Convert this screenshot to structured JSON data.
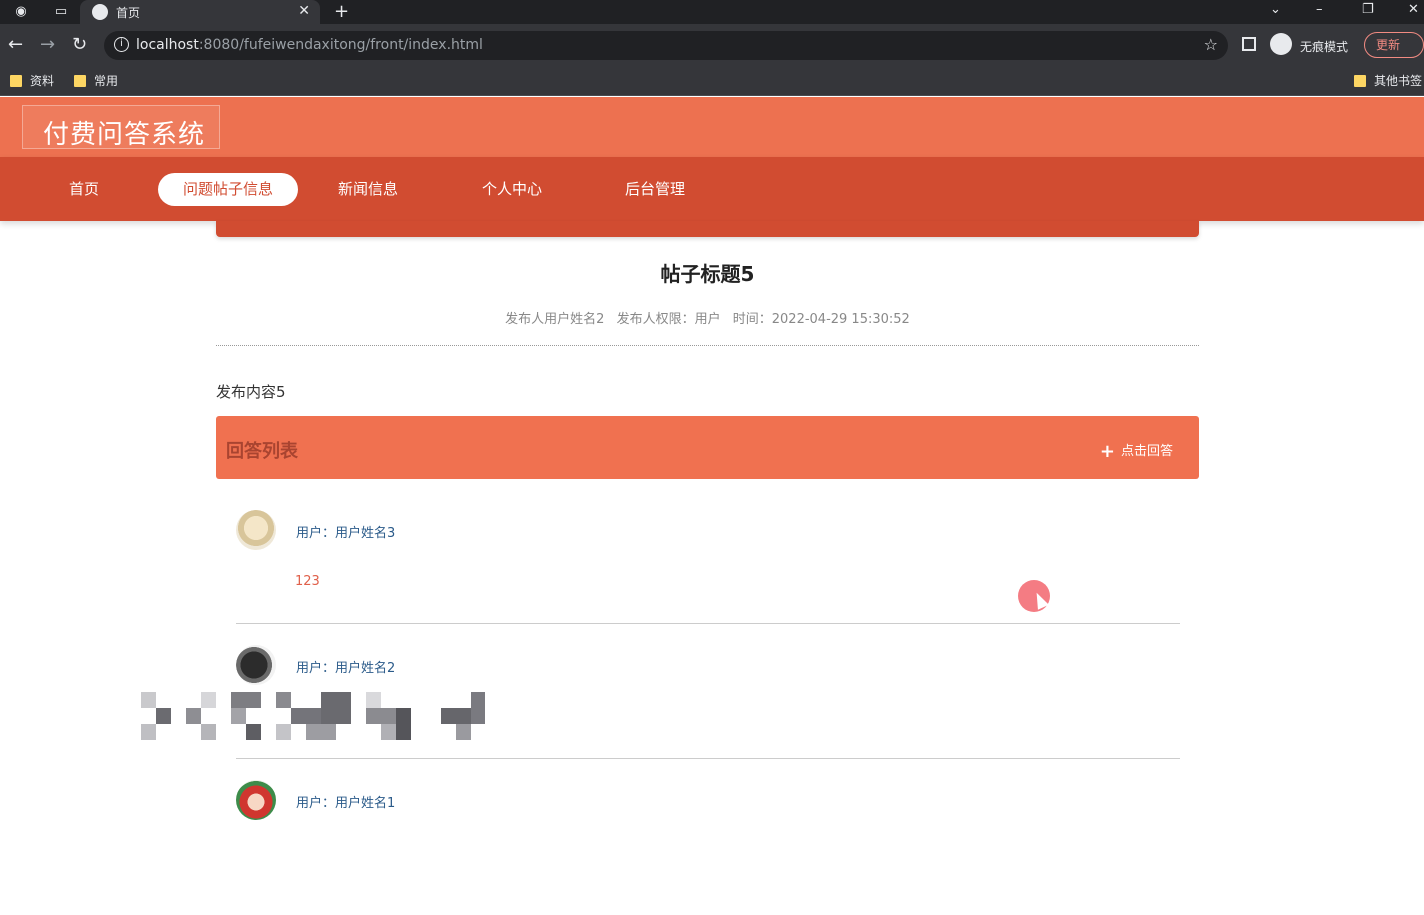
{
  "browser": {
    "tab_title": "首页",
    "new_tab": "+",
    "url_host": "localhost",
    "url_rest": ":8080/fufeiwendaxitong/front/index.html",
    "incognito_label": "无痕模式",
    "update_label": "更新",
    "bookmarks": [
      "资料",
      "常用"
    ],
    "other_bookmarks": "其他书签"
  },
  "site": {
    "logo": "付费问答系统",
    "nav": [
      "首页",
      "问题帖子信息",
      "新闻信息",
      "个人中心",
      "后台管理"
    ],
    "active_nav": 1
  },
  "post": {
    "title": "帖子标题5",
    "publisher": "发布人用户姓名2",
    "permission": "发布人权限：用户",
    "time": "时间：2022-04-29 15:30:52",
    "content": "发布内容5"
  },
  "answers": {
    "header": "回答列表",
    "reply_label": "点击回答",
    "items": [
      {
        "user": "用户：用户姓名3",
        "text": "123"
      },
      {
        "user": "用户：用户姓名2",
        "text": ""
      },
      {
        "user": "用户：用户姓名1",
        "text": ""
      }
    ]
  }
}
